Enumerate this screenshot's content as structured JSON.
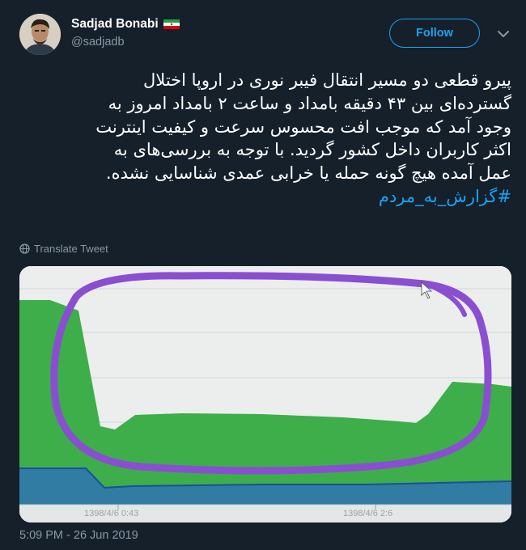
{
  "author": {
    "display_name": "Sadjad Bonabi",
    "handle": "@sadjadb",
    "flag_icon": "iran-flag-icon"
  },
  "follow_label": "Follow",
  "tweet": {
    "lines": [
      "پیرو قطعی دو مسیر انتقال فیبر نوری در اروپا اختلال",
      "گسترده‌ای بین ۴۳ دقیقه بامداد و ساعت ۲ بامداد امروز به",
      "وجود آمد که موجب افت محسوس سرعت و کیفیت اینترنت",
      "اکثر کاربران داخل کشور گردید. با توجه به بررسی‌های به",
      "عمل آمده هیچ گونه حمله یا خرابی عمدی شناسایی نشده."
    ],
    "hashtag": "#گزارش_به_مردم"
  },
  "translate_label": "Translate Tweet",
  "media": {
    "x_labels": [
      "1398/4/6 0:43",
      "1398/4/6 2:6"
    ],
    "colors": {
      "green": "#3dae4a",
      "blue": "#2b6fb0",
      "annotation": "#8a4fd0"
    }
  },
  "timestamp": "5:09 PM - 26 Jun 2019"
}
